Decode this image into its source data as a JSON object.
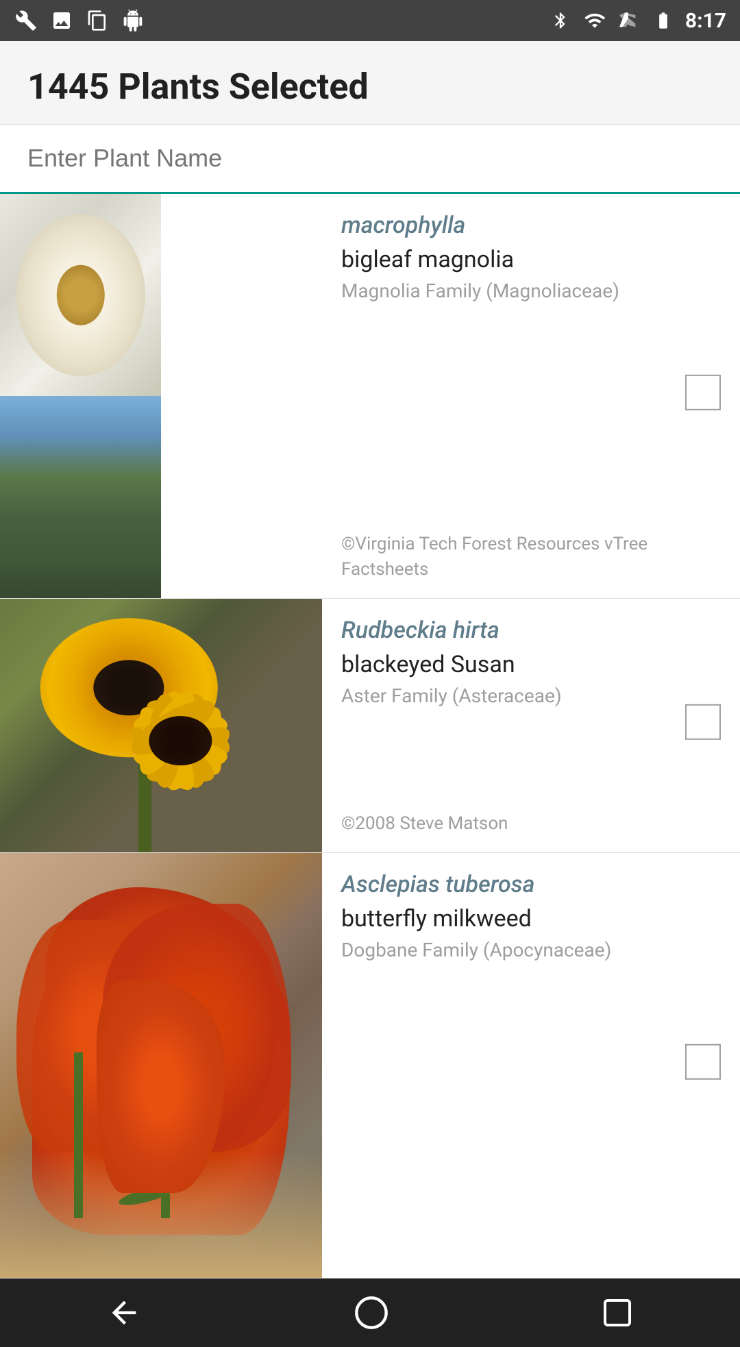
{
  "statusBar": {
    "time": "8:17",
    "icons": [
      "wrench",
      "image",
      "download",
      "android",
      "bluetooth",
      "wifi",
      "signal",
      "battery"
    ]
  },
  "header": {
    "title": "1445 Plants Selected"
  },
  "search": {
    "placeholder": "Enter Plant Name",
    "value": ""
  },
  "plants": [
    {
      "id": "magnolia-macrophylla",
      "scientific": "macrophylla",
      "common": "bigleaf magnolia",
      "family": "Magnolia Family (Magnoliaceae)",
      "copyright": "©Virginia Tech Forest Resources vTree Factsheets",
      "checked": false
    },
    {
      "id": "rudbeckia-hirta",
      "scientific": "Rudbeckia hirta",
      "common": "blackeyed Susan",
      "family": "Aster Family (Asteraceae)",
      "copyright": "©2008 Steve Matson",
      "checked": false
    },
    {
      "id": "asclepias-tuberosa",
      "scientific": "Asclepias tuberosa",
      "common": "butterfly milkweed",
      "family": "Dogbane Family (Apocynaceae)",
      "copyright": "",
      "checked": false
    }
  ],
  "navBar": {
    "back": "back",
    "home": "home",
    "recents": "recents"
  }
}
